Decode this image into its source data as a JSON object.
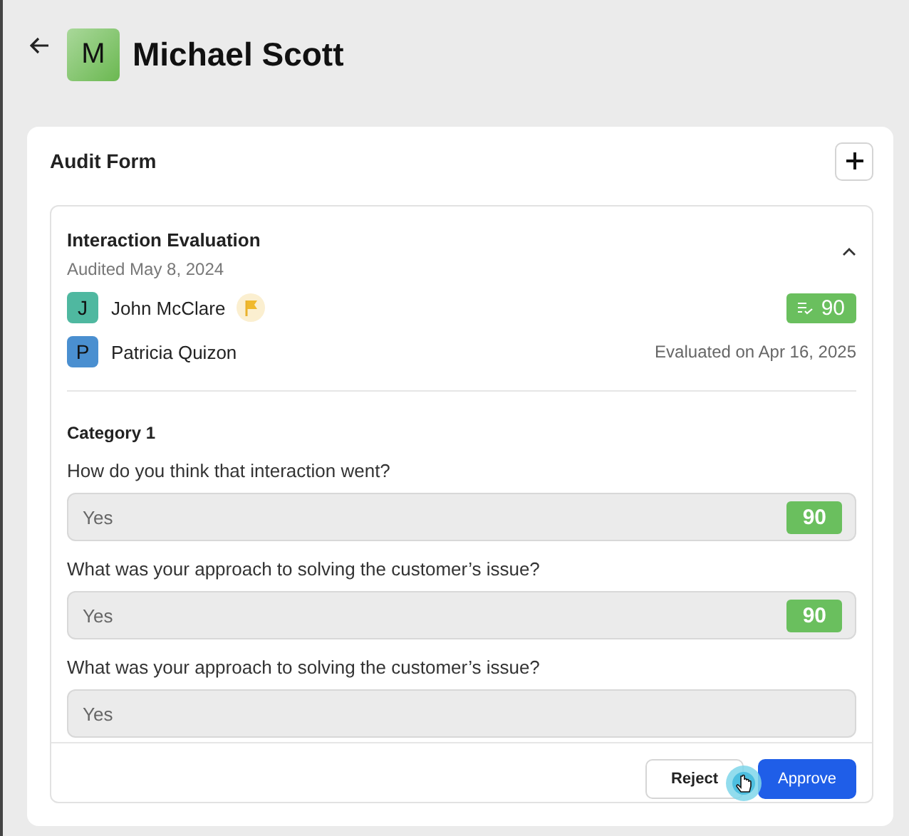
{
  "header": {
    "avatar_letter": "M",
    "name": "Michael Scott"
  },
  "card": {
    "title": "Audit Form",
    "evaluation": {
      "title": "Interaction Evaluation",
      "subtitle": "Audited May 8, 2024",
      "expanded": true,
      "people": [
        {
          "letter": "J",
          "name": "John McClare",
          "color": "#4fb8a0",
          "flagged": true,
          "score": "90"
        },
        {
          "letter": "P",
          "name": "Patricia Quizon",
          "color": "#4a8fd0",
          "flagged": false,
          "note": "Evaluated on Apr 16, 2025"
        }
      ],
      "category": "Category 1",
      "questions": [
        {
          "question": "How do you think that interaction went?",
          "answer": "Yes",
          "score": "90"
        },
        {
          "question": "What was your approach to solving the customer’s issue?",
          "answer": "Yes",
          "score": "90"
        },
        {
          "question": "What was your approach to solving the customer’s issue?",
          "answer": "Yes"
        }
      ]
    },
    "buttons": [
      {
        "label": "Reject",
        "kind": "secondary"
      },
      {
        "label": "Approve",
        "kind": "primary"
      }
    ]
  }
}
